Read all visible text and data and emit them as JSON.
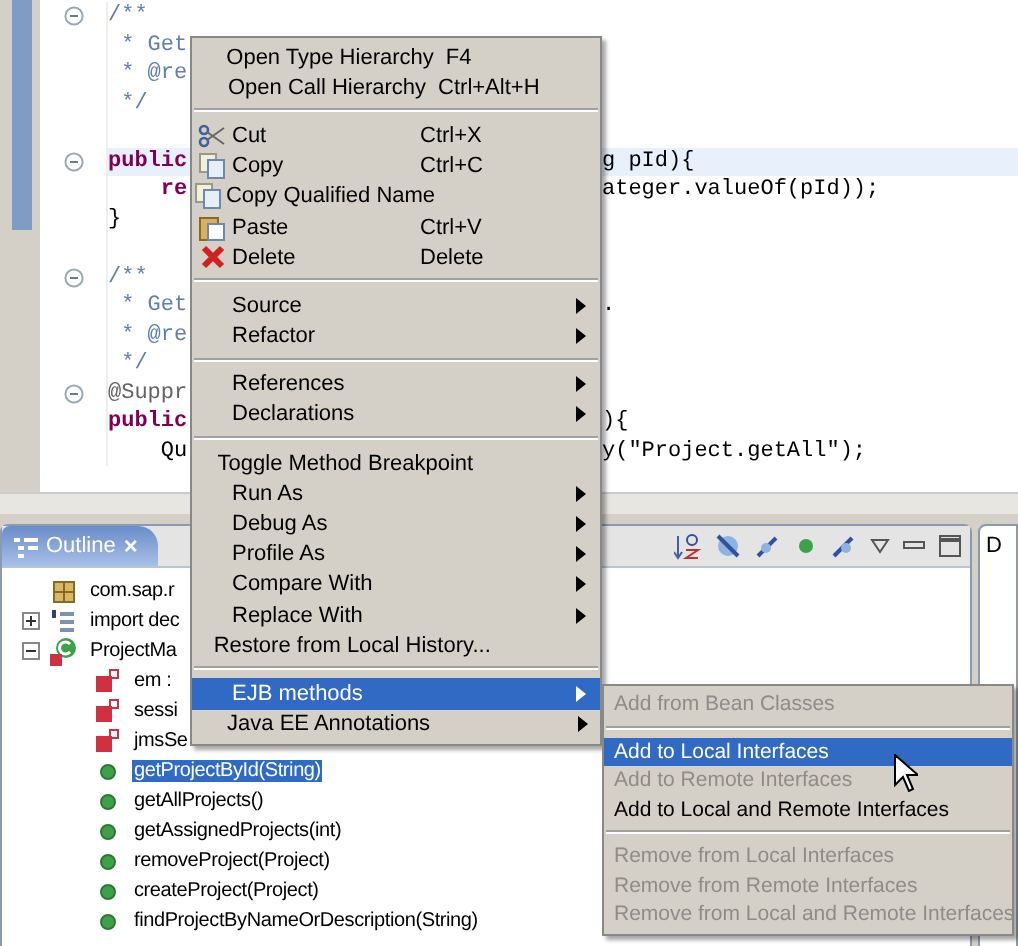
{
  "editor": {
    "lines": [
      {
        "left": "/**",
        "kind": "comment",
        "fold": true,
        "current": false
      },
      {
        "left": " * Get",
        "kind": "comment",
        "fold": false,
        "current": false
      },
      {
        "left": " * @re",
        "kind": "comment",
        "fold": false,
        "current": false
      },
      {
        "left": " */",
        "kind": "comment",
        "fold": false,
        "current": false
      },
      {
        "fold": false,
        "current": false
      },
      {
        "left": "public",
        "kind": "keyword",
        "right": "g pId){",
        "fold": true,
        "current": true
      },
      {
        "left": "    re",
        "kind": "keyword",
        "right": "ateger.valueOf(pId));",
        "fold": false,
        "current": false
      },
      {
        "left": "}",
        "kind": "code",
        "fold": false,
        "current": false
      },
      {
        "fold": false,
        "current": false
      },
      {
        "left": "/**",
        "kind": "comment",
        "fold": true,
        "current": false
      },
      {
        "left": " * Get",
        "kind": "comment",
        "right": ".",
        "fold": false,
        "current": false
      },
      {
        "left": " * @re",
        "kind": "comment",
        "fold": false,
        "current": false
      },
      {
        "left": " */",
        "kind": "comment",
        "fold": false,
        "current": false
      },
      {
        "left": "@Suppr",
        "kind": "annotation",
        "fold": true,
        "current": false
      },
      {
        "left": "public",
        "kind": "keyword",
        "right": "){",
        "fold": false,
        "current": false
      },
      {
        "left": "    Qu",
        "kind": "code",
        "right": "y(\"Project.getAll\");",
        "fold": false,
        "current": false
      }
    ]
  },
  "context_menu": {
    "items": [
      {
        "kind": "plain",
        "label": "Open Type Hierarchy",
        "shortcut": "F4",
        "submenu": false,
        "selected": false
      },
      {
        "kind": "plain",
        "label": "Open Call Hierarchy",
        "shortcut": "Ctrl+Alt+H",
        "submenu": false,
        "selected": false
      },
      {
        "kind": "separator"
      },
      {
        "kind": "cut",
        "label": "Cut",
        "shortcut": "Ctrl+X",
        "submenu": false,
        "selected": false
      },
      {
        "kind": "copy",
        "label": "Copy",
        "shortcut": "Ctrl+C",
        "submenu": false,
        "selected": false
      },
      {
        "kind": "copy",
        "label": "Copy Qualified Name",
        "submenu": false,
        "selected": false
      },
      {
        "kind": "paste",
        "label": "Paste",
        "shortcut": "Ctrl+V",
        "submenu": false,
        "selected": false
      },
      {
        "kind": "delete",
        "label": "Delete",
        "shortcut": "Delete",
        "submenu": false,
        "selected": false
      },
      {
        "kind": "separator"
      },
      {
        "kind": "plain",
        "label": "Source",
        "submenu": true,
        "selected": false
      },
      {
        "kind": "plain",
        "label": "Refactor",
        "submenu": true,
        "selected": false
      },
      {
        "kind": "separator"
      },
      {
        "kind": "plain",
        "label": "References",
        "submenu": true,
        "selected": false
      },
      {
        "kind": "plain",
        "label": "Declarations",
        "submenu": true,
        "selected": false
      },
      {
        "kind": "separator"
      },
      {
        "kind": "plain",
        "label": "Toggle Method Breakpoint",
        "submenu": false,
        "selected": false
      },
      {
        "kind": "plain",
        "label": "Run As",
        "submenu": true,
        "selected": false
      },
      {
        "kind": "plain",
        "label": "Debug As",
        "submenu": true,
        "selected": false
      },
      {
        "kind": "plain",
        "label": "Profile As",
        "submenu": true,
        "selected": false
      },
      {
        "kind": "plain",
        "label": "Compare With",
        "submenu": true,
        "selected": false
      },
      {
        "kind": "plain",
        "label": "Replace With",
        "submenu": true,
        "selected": false
      },
      {
        "kind": "plain",
        "label": "Restore from Local History...",
        "submenu": false,
        "selected": false
      },
      {
        "kind": "separator"
      },
      {
        "kind": "plain",
        "label": "EJB methods",
        "submenu": true,
        "selected": true
      },
      {
        "kind": "plain",
        "label": "Java EE Annotations",
        "submenu": true,
        "selected": false
      }
    ]
  },
  "submenu": {
    "items": [
      {
        "kind": "item",
        "label": "Add from Bean Classes",
        "disabled": true,
        "selected": false
      },
      {
        "kind": "separator"
      },
      {
        "kind": "item",
        "label": "Add to Local Interfaces",
        "disabled": false,
        "selected": true
      },
      {
        "kind": "item",
        "label": "Add to Remote Interfaces",
        "disabled": true,
        "selected": false
      },
      {
        "kind": "item",
        "label": "Add to Local and Remote Interfaces",
        "disabled": false,
        "selected": false
      },
      {
        "kind": "separator"
      },
      {
        "kind": "item",
        "label": "Remove from Local Interfaces",
        "disabled": true,
        "selected": false
      },
      {
        "kind": "item",
        "label": "Remove from Remote Interfaces",
        "disabled": true,
        "selected": false
      },
      {
        "kind": "item",
        "label": "Remove from Local and Remote Interfaces",
        "disabled": true,
        "selected": false
      }
    ]
  },
  "outline": {
    "tab": {
      "label": "Outline",
      "close": "×"
    },
    "tree": [
      {
        "label": "com.sap.r",
        "kind": "package",
        "selected": false
      },
      {
        "label": "import dec",
        "kind": "imports",
        "expanded": false,
        "selected": false
      },
      {
        "label": "ProjectMa",
        "kind": "class",
        "expanded": true,
        "selected": false,
        "children": [
          {
            "label": "em :",
            "kind": "field",
            "selected": false
          },
          {
            "label": "sessi",
            "kind": "field",
            "selected": false
          },
          {
            "label": "jmsSe",
            "kind": "field",
            "selected": false
          },
          {
            "label": "getProjectById(String)",
            "kind": "method",
            "selected": true
          },
          {
            "label": "getAllProjects()",
            "kind": "method",
            "selected": false
          },
          {
            "label": "getAssignedProjects(int)",
            "kind": "method",
            "selected": false
          },
          {
            "label": "removeProject(Project)",
            "kind": "method",
            "selected": false
          },
          {
            "label": "createProject(Project)",
            "kind": "method",
            "selected": false
          },
          {
            "label": "findProjectByNameOrDescription(String)",
            "kind": "method",
            "selected": false
          }
        ]
      }
    ]
  },
  "side_panel": {
    "tab": {
      "label": "D"
    }
  }
}
